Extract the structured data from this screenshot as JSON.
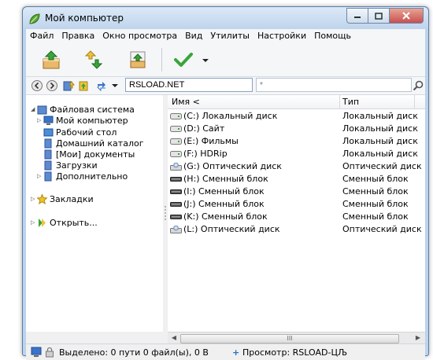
{
  "window": {
    "title": "Мой компьютер",
    "minimize_icon": "minimize-icon",
    "maximize_icon": "maximize-icon",
    "close_icon": "close-icon"
  },
  "menu": [
    "Файл",
    "Правка",
    "Окно просмотра",
    "Вид",
    "Утилиты",
    "Настройки",
    "Помощь"
  ],
  "toolbar": {
    "buttons": [
      "extract-icon",
      "move-arrows-icon",
      "add-archive-icon",
      "check-icon",
      "dropdown-arrow-icon"
    ]
  },
  "address": {
    "value": "RSLOAD.NET",
    "filter_placeholder": "*"
  },
  "tree": {
    "items": [
      {
        "label": "Файловая система",
        "icon": "folder-icon",
        "expanded": true
      },
      {
        "label": "Мой компьютер",
        "icon": "computer-icon"
      },
      {
        "label": "Рабочий стол",
        "icon": "desktop-icon"
      },
      {
        "label": "Домашний каталог",
        "icon": "folder-icon"
      },
      {
        "label": "[Мои] документы",
        "icon": "folder-icon"
      },
      {
        "label": "Загрузки",
        "icon": "folder-icon"
      },
      {
        "label": "Дополнительно",
        "icon": "folder-icon"
      },
      {
        "label": "Закладки",
        "icon": "star-icon"
      },
      {
        "label": "Открыть...",
        "icon": "open-icon"
      }
    ]
  },
  "columns": {
    "name": "Имя <",
    "type": "Тип"
  },
  "rows": [
    {
      "name": "(C:) Локальный диск",
      "type": "Локальный диск",
      "icon": "hard-drive-icon"
    },
    {
      "name": "(D:) Сайт",
      "type": "Локальный диск",
      "icon": "hard-drive-icon"
    },
    {
      "name": "(E:) Фильмы",
      "type": "Локальный диск",
      "icon": "hard-drive-icon"
    },
    {
      "name": "(F:) HDRip",
      "type": "Локальный диск",
      "icon": "hard-drive-icon"
    },
    {
      "name": "(G:) Оптический диск",
      "type": "Оптический диск",
      "icon": "optical-drive-icon"
    },
    {
      "name": "(H:) Сменный блок",
      "type": "Сменный блок",
      "icon": "removable-drive-icon"
    },
    {
      "name": "(I:) Сменный блок",
      "type": "Сменный блок",
      "icon": "removable-drive-icon"
    },
    {
      "name": "(J:) Сменный блок",
      "type": "Сменный блок",
      "icon": "removable-drive-icon"
    },
    {
      "name": "(K:) Сменный блок",
      "type": "Сменный блок",
      "icon": "removable-drive-icon"
    },
    {
      "name": "(L:) Оптический диск",
      "type": "Оптический диск",
      "icon": "optical-drive-icon"
    }
  ],
  "scrollbar": {
    "thumb_label": "III"
  },
  "status": {
    "selected": "Выделено: 0 пути 0 файл(ы), 0 B",
    "preview": "Просмотр: RSLOAD-ЦЉ"
  }
}
